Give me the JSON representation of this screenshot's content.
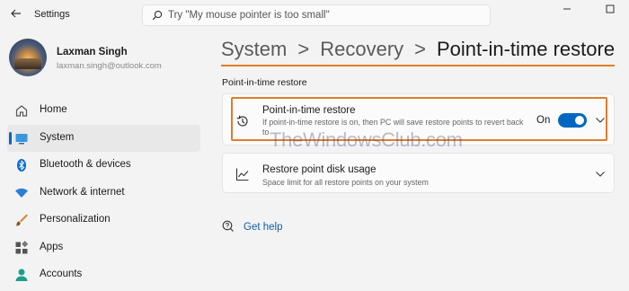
{
  "window": {
    "app_title": "Settings",
    "minimize_glyph": "—",
    "maximize_glyph": "☐",
    "back_glyph": "←"
  },
  "search": {
    "placeholder": "Try \"My mouse pointer is too small\"",
    "icon": "search-icon"
  },
  "profile": {
    "name": "Laxman Singh",
    "email": "laxman.singh@outlook.com"
  },
  "sidebar": {
    "items": [
      {
        "label": "Home",
        "icon": "home-icon",
        "active": false
      },
      {
        "label": "System",
        "icon": "system-icon",
        "active": true
      },
      {
        "label": "Bluetooth & devices",
        "icon": "bluetooth-icon",
        "active": false
      },
      {
        "label": "Network & internet",
        "icon": "wifi-icon",
        "active": false
      },
      {
        "label": "Personalization",
        "icon": "brush-icon",
        "active": false
      },
      {
        "label": "Apps",
        "icon": "apps-icon",
        "active": false
      },
      {
        "label": "Accounts",
        "icon": "account-icon",
        "active": false
      }
    ]
  },
  "main": {
    "breadcrumb": [
      "System",
      "Recovery",
      "Point-in-time restore"
    ],
    "breadcrumb_separator": ">",
    "section_title": "Point-in-time restore",
    "cards": [
      {
        "title": "Point-in-time restore",
        "description": "If point-in-time restore is on, then PC will save restore points to revert back to",
        "toggle_label": "On",
        "toggle_on": true,
        "icon": "history-icon"
      },
      {
        "title": "Restore point disk usage",
        "description": "Space limit for all restore points on your system",
        "icon": "chart-icon"
      }
    ],
    "help_link": "Get help"
  },
  "watermark": "TheWindowsClub.com",
  "colors": {
    "accent": "#0067c0",
    "highlight": "#e07d2a",
    "background": "#f3f3f3",
    "card": "#fbfbfb"
  }
}
